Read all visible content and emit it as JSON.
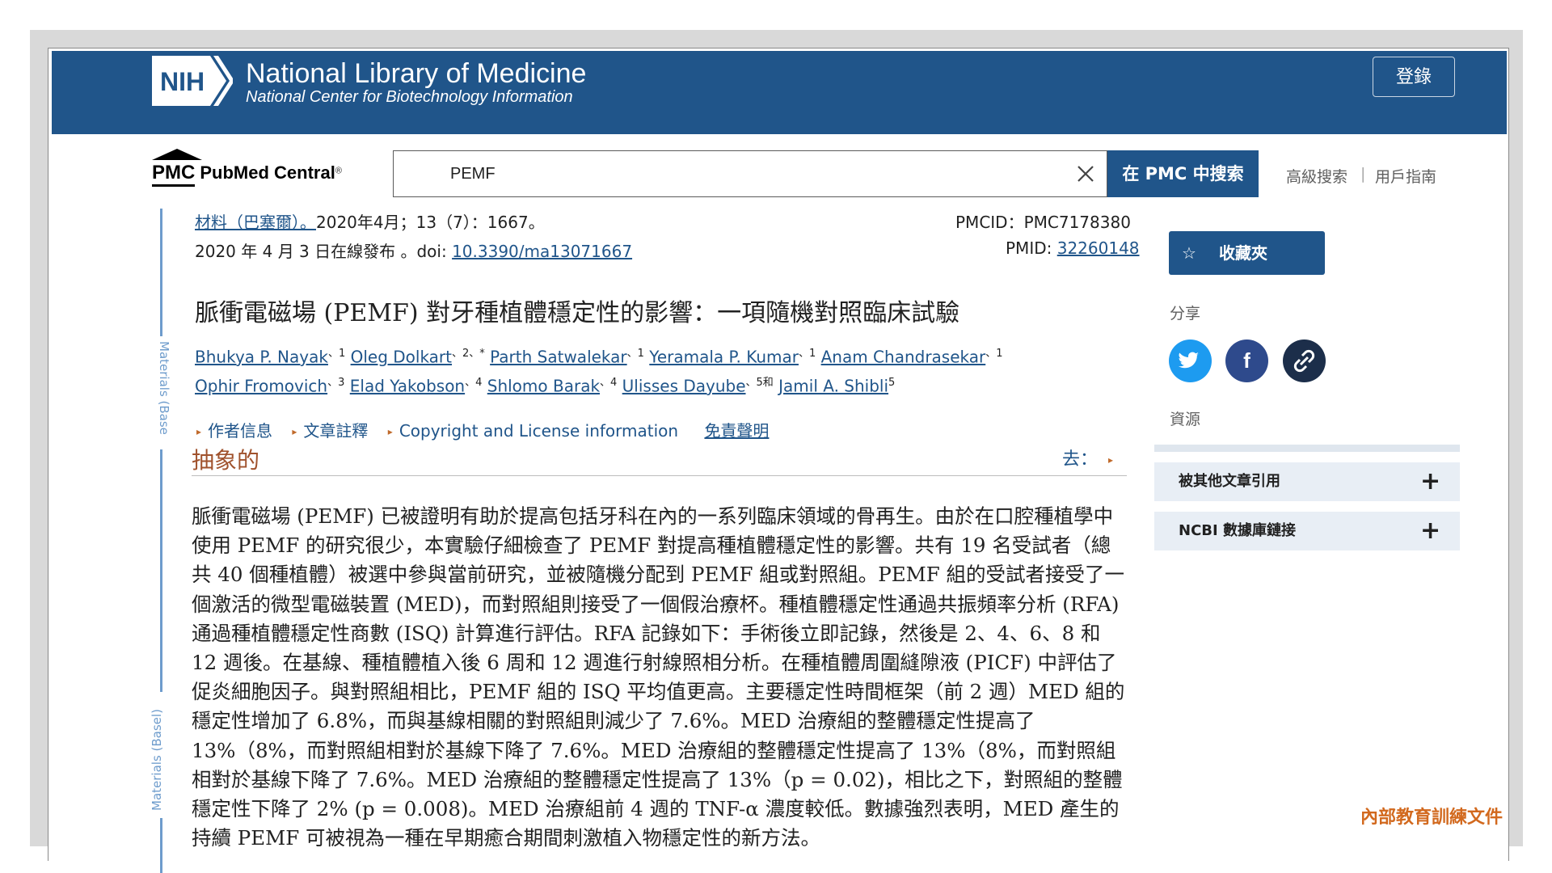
{
  "header": {
    "logo_text": "NIH",
    "title": "National Library of Medicine",
    "subtitle": "National Center for Biotechnology Information",
    "login_label": "登錄"
  },
  "search": {
    "pmc_mark": "PMC",
    "pmc_name": "PubMed Central",
    "pmc_reg": "®",
    "query": "PEMF",
    "button_label": "在 PMC 中搜索",
    "advanced_label": "高級搜索",
    "separator": "|",
    "guide_label": "用戶指南"
  },
  "journal_strip": {
    "label_top": "Materials (Base",
    "label_bottom": "Materials (Basel)"
  },
  "article": {
    "journal_link": "材料（巴塞爾）。",
    "citation": "2020年4月；13（7）：1667。",
    "published": "2020 年 4 月 3 日在線發布 。doi:",
    "doi": "10.3390/ma13071667",
    "pmcid": "PMCID：PMC7178380",
    "pmid_label": "PMID:",
    "pmid": "32260148",
    "title": "脈衝電磁場 (PEMF) 對牙種植體穩定性的影響：一項隨機對照臨床試驗",
    "authors_line1": [
      {
        "name": "Bhukya P. Nayak",
        "sup": "、1"
      },
      {
        "name": "Oleg Dolkart",
        "sup": "、2、*"
      },
      {
        "name": "Parth Satwalekar",
        "sup": "、1"
      },
      {
        "name": "Yeramala P. Kumar",
        "sup": "、1"
      },
      {
        "name": "Anam Chandrasekar",
        "sup": "、1"
      }
    ],
    "authors_line2": [
      {
        "name": "Ophir Fromovich",
        "sup": "、3"
      },
      {
        "name": "Elad Yakobson",
        "sup": "、4"
      },
      {
        "name": "Shlomo Barak",
        "sup": "、4"
      },
      {
        "name": "Ulisses Dayube",
        "sup": "、5和"
      },
      {
        "name": "Jamil A. Shibli",
        "sup": "5"
      }
    ],
    "info_links": [
      "作者信息",
      "文章註釋",
      "Copyright and License information"
    ],
    "disclaimer": "免責聲明",
    "section_heading": "抽象的",
    "goto_label": "去：",
    "abstract": "脈衝電磁場 (PEMF) 已被證明有助於提高包括牙科在內的一系列臨床領域的骨再生。由於在口腔種植學中使用 PEMF 的研究很少，本實驗仔細檢查了 PEMF 對提高種植體穩定性的影響。共有 19 名受試者（總共 40 個種植體）被選中參與當前研究，並被隨機分配到 PEMF 組或對照組。PEMF 組的受試者接受了一個激活的微型電磁裝置 (MED)，而對照組則接受了一個假治療杯。種植體穩定性通過共振頻率分析 (RFA) 通過種植體穩定性商數 (ISQ) 計算進行評估。RFA 記錄如下：手術後立即記錄，然後是 2、4、6、8 和 12 週後。在基線、種植體植入後 6 周和 12 週進行射線照相分析。在種植體周圍縫隙液 (PICF) 中評估了促炎細胞因子。與對照組相比，PEMF 組的 ISQ 平均值更高。主要穩定性時間框架（前 2 週）MED 組的穩定性增加了 6.8%，而與基線相關的對照組則減少了 7.6%。MED 治療組的整體穩定性提高了 13%（8%，而對照組相對於基線下降了 7.6%。MED 治療組的整體穩定性提高了 13%（8%，而對照組相對於基線下降了 7.6%。MED 治療組的整體穩定性提高了 13%（p = 0.02)，相比之下，對照組的整體穩定性下降了 2% (p = 0.008)。MED 治療組前 4 週的 TNF-α 濃度較低。數據強烈表明，MED 產生的持續 PEMF 可被視為一種在早期癒合期間刺激植入物穩定性的新方法。"
  },
  "sidebar": {
    "favorite_label": "收藏夾",
    "share_label": "分享",
    "resources_label": "資源",
    "accordions": [
      {
        "label": "被其他文章引用",
        "plus": "+"
      },
      {
        "label": "NCBI 數據庫鏈接",
        "plus": "+"
      }
    ]
  },
  "watermark": "內部教育訓練文件",
  "colors": {
    "brand_blue": "#20558a",
    "twitter": "#1d9bf0",
    "facebook": "#2e4a8c",
    "heading_brown": "#a0522d",
    "watermark": "#d2691e"
  }
}
